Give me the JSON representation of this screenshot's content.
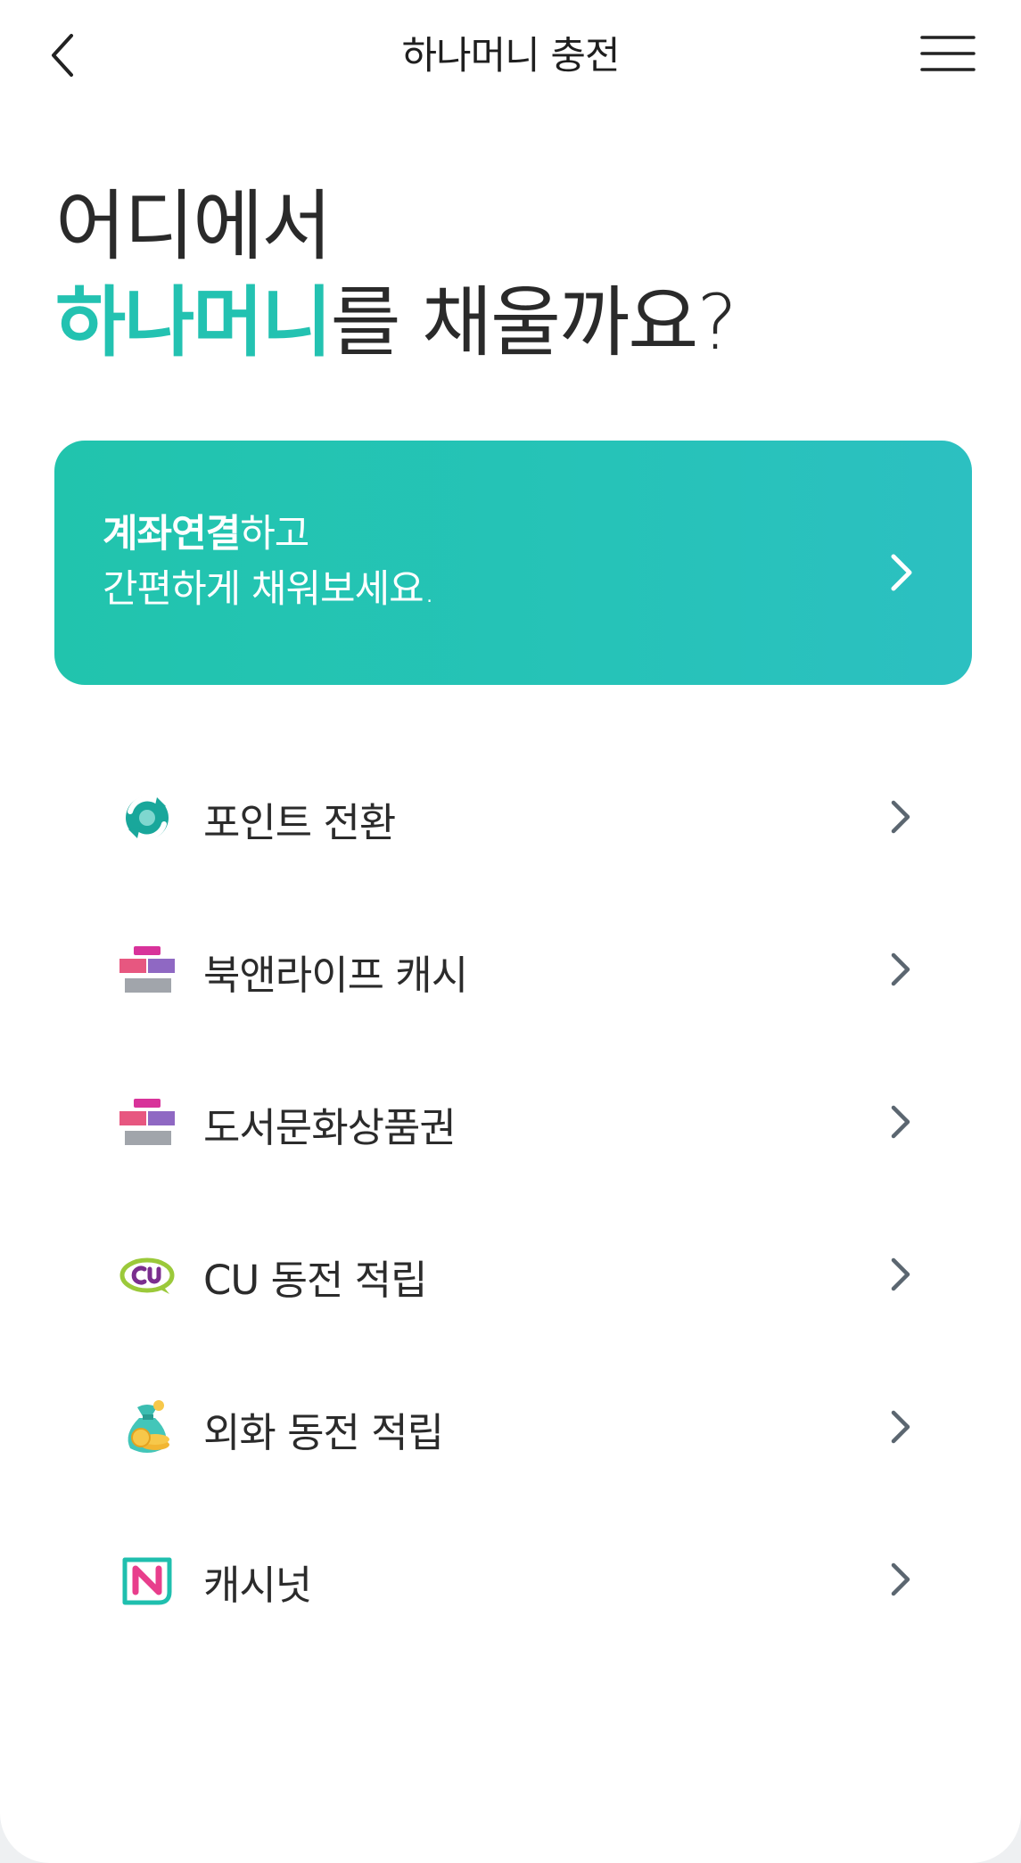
{
  "header": {
    "title": "하나머니 충전",
    "back_icon": "back-chevron-icon",
    "menu_icon": "hamburger-menu-icon"
  },
  "headline": {
    "line1": "어디에서",
    "accent": "하나머니",
    "line2_rest": "를 채울까요?"
  },
  "promo": {
    "bold": "계좌연결",
    "light1": "하고",
    "light2": "간편하게 채워보세요.",
    "icon": "chevron-right-icon"
  },
  "colors": {
    "accent": "#23c2b1",
    "promo_start": "#21c4ad",
    "promo_end": "#2cc0c1",
    "chevron": "#5b6670"
  },
  "items": [
    {
      "label": "포인트 전환",
      "icon": "point-exchange-icon"
    },
    {
      "label": "북앤라이프 캐시",
      "icon": "book-culture-gift-icon"
    },
    {
      "label": "도서문화상품권",
      "icon": "book-culture-gift-icon"
    },
    {
      "label": "CU 동전 적립",
      "icon": "cu-logo-icon"
    },
    {
      "label": "외화 동전 적립",
      "icon": "coin-pouch-icon"
    },
    {
      "label": "캐시넛",
      "icon": "cashnut-logo-icon"
    }
  ]
}
